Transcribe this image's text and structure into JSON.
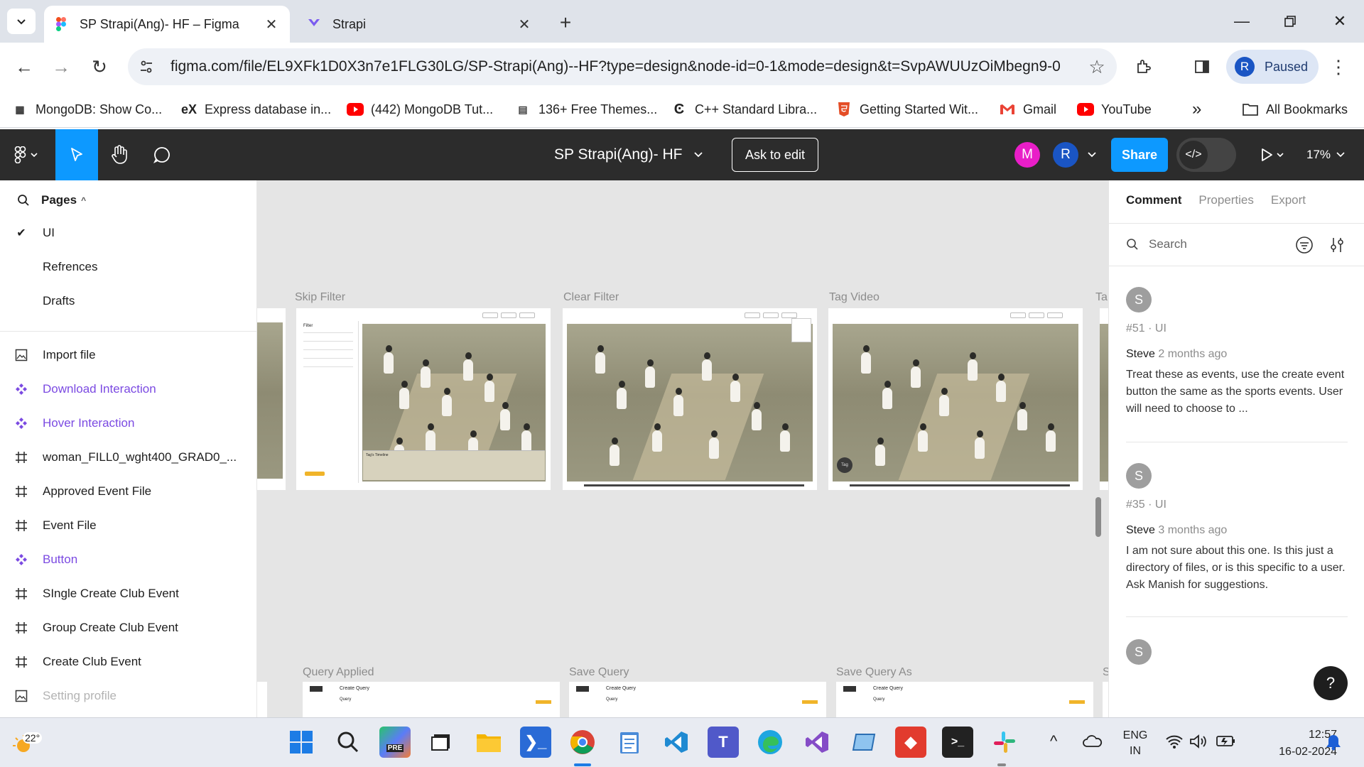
{
  "browser": {
    "tabs": [
      {
        "title": "SP Strapi(Ang)- HF – Figma",
        "active": true
      },
      {
        "title": "Strapi",
        "active": false
      }
    ],
    "url": "figma.com/file/EL9XFk1D0X3n7e1FLG30LG/SP-Strapi(Ang)--HF?type=design&node-id=0-1&mode=design&t=SvpAWUUzOiMbegn9-0",
    "profile": {
      "initial": "R",
      "status": "Paused"
    },
    "bookmarks": [
      "MongoDB: Show Co...",
      "Express database in...",
      "(442) MongoDB Tut...",
      "136+ Free Themes...",
      "C++ Standard Libra...",
      "Getting Started Wit...",
      "Gmail",
      "YouTube"
    ],
    "more_bookmarks": "»",
    "all_bookmarks": "All Bookmarks"
  },
  "figma": {
    "doc_title": "SP Strapi(Ang)- HF",
    "ask_to_edit": "Ask to edit",
    "avatars": [
      {
        "initial": "M",
        "color": "#e91ec8"
      },
      {
        "initial": "R",
        "color": "#1a55c4"
      }
    ],
    "share": "Share",
    "zoom": "17%",
    "pages_label": "Pages",
    "pages": [
      "UI",
      "Refrences",
      "Drafts"
    ],
    "layers": [
      {
        "name": "Import file",
        "kind": "image"
      },
      {
        "name": "Download Interaction",
        "kind": "component"
      },
      {
        "name": "Hover Interaction",
        "kind": "component"
      },
      {
        "name": "woman_FILL0_wght400_GRAD0_...",
        "kind": "frame"
      },
      {
        "name": "Approved Event File",
        "kind": "frame"
      },
      {
        "name": "Event File",
        "kind": "frame"
      },
      {
        "name": "Button",
        "kind": "component"
      },
      {
        "name": "SIngle Create Club Event",
        "kind": "frame"
      },
      {
        "name": "Group Create Club Event",
        "kind": "frame"
      },
      {
        "name": "Create Club Event",
        "kind": "frame"
      },
      {
        "name": "Setting profile",
        "kind": "muted"
      }
    ],
    "canvas": {
      "row1_labels": [
        "Skip Filter",
        "Clear Filter",
        "Tag Video",
        "Ta"
      ],
      "row2_labels": [
        "Query Applied",
        "Save Query",
        "Save Query As",
        "S"
      ],
      "mini_text": {
        "filter": "Filter",
        "tag_timeline": "Tag's Timeline",
        "create_query": "Create Query",
        "query": "Query",
        "tag": "Tag"
      }
    },
    "right_panel": {
      "tabs": [
        "Comment",
        "Properties",
        "Export"
      ],
      "search_placeholder": "Search",
      "comments": [
        {
          "avatar": "S",
          "meta": "#51 · UI",
          "author": "Steve",
          "time": "2 months ago",
          "text": "Treat these as events, use the create event button the same as the sports events.  User will need to choose to ..."
        },
        {
          "avatar": "S",
          "meta": "#35 · UI",
          "author": "Steve",
          "time": "3 months ago",
          "text": "I am not sure about this one.  Is this just a directory of files, or is this specific to a user.  Ask Manish for suggestions."
        },
        {
          "avatar": "S",
          "meta": "",
          "author": "",
          "time": "",
          "text": ""
        }
      ],
      "help": "?"
    }
  },
  "taskbar": {
    "weather": "22°",
    "language": [
      "ENG",
      "IN"
    ],
    "time": "12:57",
    "date": "16-02-2024"
  },
  "colors": {
    "figma_blue": "#0d99ff",
    "component_purple": "#7b4ae2",
    "figma_dark": "#2c2c2c"
  }
}
